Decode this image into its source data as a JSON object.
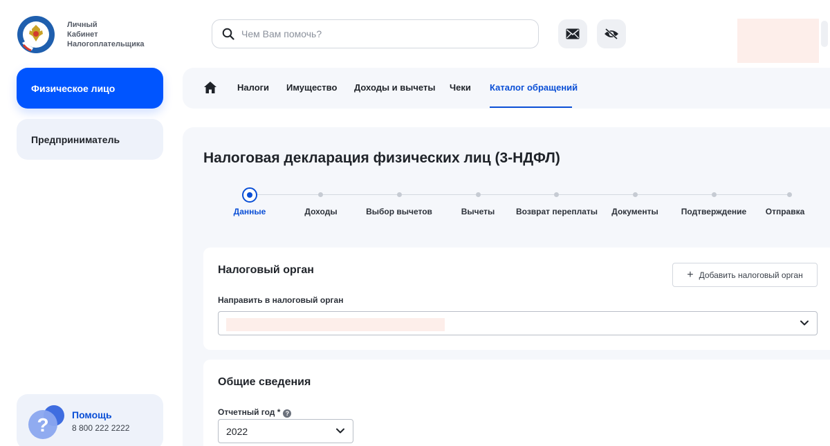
{
  "header": {
    "brand_line1": "Личный",
    "brand_line2": "Кабинет",
    "brand_line3": "Налогоплательщика",
    "search_placeholder": "Чем Вам помочь?"
  },
  "sidebar": {
    "items": [
      {
        "label": "Физическое лицо",
        "active": true
      },
      {
        "label": "Предприниматель",
        "active": false
      }
    ],
    "help": {
      "title": "Помощь",
      "phone": "8 800 222 2222"
    }
  },
  "nav": {
    "items": [
      {
        "label": "Налоги"
      },
      {
        "label": "Имущество"
      },
      {
        "label": "Доходы и вычеты"
      },
      {
        "label": "Чеки"
      },
      {
        "label": "Каталог обращений",
        "active": true
      }
    ]
  },
  "page": {
    "title": "Налоговая декларация физических лиц (3-НДФЛ)"
  },
  "stepper": {
    "steps": [
      {
        "label": "Данные",
        "current": true
      },
      {
        "label": "Доходы"
      },
      {
        "label": "Выбор вычетов"
      },
      {
        "label": "Вычеты"
      },
      {
        "label": "Возврат переплаты"
      },
      {
        "label": "Документы"
      },
      {
        "label": "Подтверждение"
      },
      {
        "label": "Отправка"
      }
    ]
  },
  "tax_authority": {
    "title": "Налоговый орган",
    "add_button": "Добавить налоговый орган",
    "field_label": "Направить в налоговый орган"
  },
  "general_info": {
    "title": "Общие сведения",
    "year_label": "Отчетный год *",
    "year_value": "2022"
  },
  "colors": {
    "accent": "#0055ff",
    "link": "#0a4fd6",
    "panel": "#f5f7fb"
  }
}
